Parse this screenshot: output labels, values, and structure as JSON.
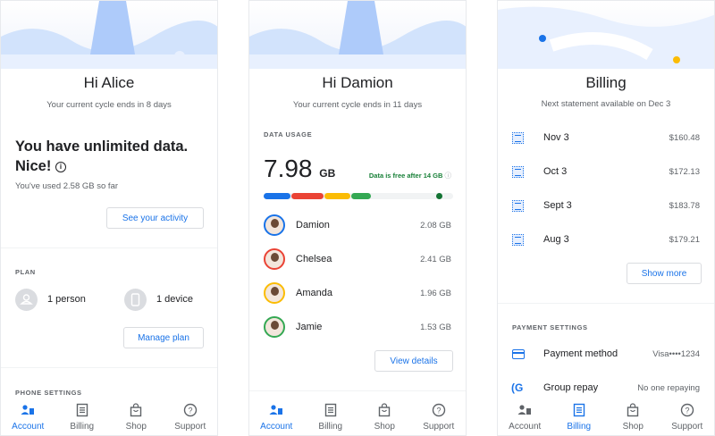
{
  "colors": {
    "accent": "#1a73e8",
    "green": "#188038",
    "red": "#ea4335",
    "yellow": "#fbbc04",
    "green_bar": "#34a853"
  },
  "nav": [
    {
      "label": "Account",
      "icon": "account-icon"
    },
    {
      "label": "Billing",
      "icon": "billing-icon"
    },
    {
      "label": "Shop",
      "icon": "shop-icon"
    },
    {
      "label": "Support",
      "icon": "help-icon"
    }
  ],
  "screen1": {
    "title": "Hi Alice",
    "subtitle": "Your current cycle ends in 8 days",
    "headline1": "You have unlimited data.",
    "headline2": "Nice!",
    "used": "You've used 2.58 GB so far",
    "activity_button": "See your activity",
    "plan_label": "PLAN",
    "person": "1 person",
    "device": "1 device",
    "manage_button": "Manage plan",
    "phone_settings_label": "PHONE SETTINGS",
    "active_nav": "Account"
  },
  "screen2": {
    "title": "Hi Damion",
    "subtitle": "Your current cycle ends in 11 days",
    "usage_label": "DATA USAGE",
    "usage_value": "7.98",
    "usage_unit": "GB",
    "free_note": "Data is free after 14 GB",
    "limit_gb": 14,
    "members": [
      {
        "name": "Damion",
        "usage": "2.08 GB",
        "gb": 2.08,
        "color": "#1a73e8"
      },
      {
        "name": "Chelsea",
        "usage": "2.41 GB",
        "gb": 2.41,
        "color": "#ea4335"
      },
      {
        "name": "Amanda",
        "usage": "1.96 GB",
        "gb": 1.96,
        "color": "#fbbc04"
      },
      {
        "name": "Jamie",
        "usage": "1.53 GB",
        "gb": 1.53,
        "color": "#34a853"
      }
    ],
    "details_button": "View details",
    "active_nav": "Account"
  },
  "screen3": {
    "title": "Billing",
    "subtitle": "Next statement available on Dec 3",
    "statements": [
      {
        "date": "Nov 3",
        "amount": "$160.48"
      },
      {
        "date": "Oct 3",
        "amount": "$172.13"
      },
      {
        "date": "Sept 3",
        "amount": "$183.78"
      },
      {
        "date": "Aug 3",
        "amount": "$179.21"
      }
    ],
    "show_more": "Show more",
    "payment_label": "PAYMENT SETTINGS",
    "payment_method": "Payment method",
    "payment_value": "Visa••••1234",
    "group_repay": "Group repay",
    "group_value": "No one repaying",
    "active_nav": "Billing"
  }
}
